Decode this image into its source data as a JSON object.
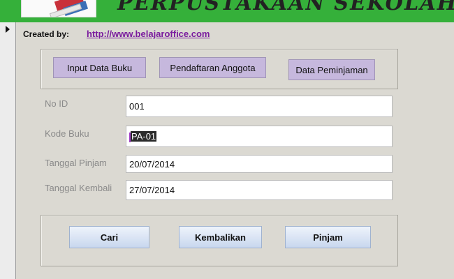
{
  "app": {
    "title": "PERPUSTAKAAN SEKOLAH",
    "created_by_label": "Created by:",
    "created_by_url": "http://www.belajaroffice.com"
  },
  "nav": [
    {
      "label": "Input Data Buku"
    },
    {
      "label": "Pendaftaran Anggota"
    },
    {
      "label": "Data Peminjaman"
    }
  ],
  "fields": [
    {
      "label": "No ID",
      "value": "001"
    },
    {
      "label": "Kode Buku",
      "value": "PA-01"
    },
    {
      "label": "Tanggal Pinjam",
      "value": "20/07/2014"
    },
    {
      "label": "Tanggal Kembali",
      "value": "27/07/2014"
    }
  ],
  "actions": [
    {
      "label": "Cari"
    },
    {
      "label": "Kembalikan"
    },
    {
      "label": "Pinjam"
    }
  ],
  "colors": {
    "title_band": "#35b03a",
    "form_background": "#dbd9d2",
    "nav_button": "#c6b8dd",
    "link": "#7a1b9e"
  }
}
